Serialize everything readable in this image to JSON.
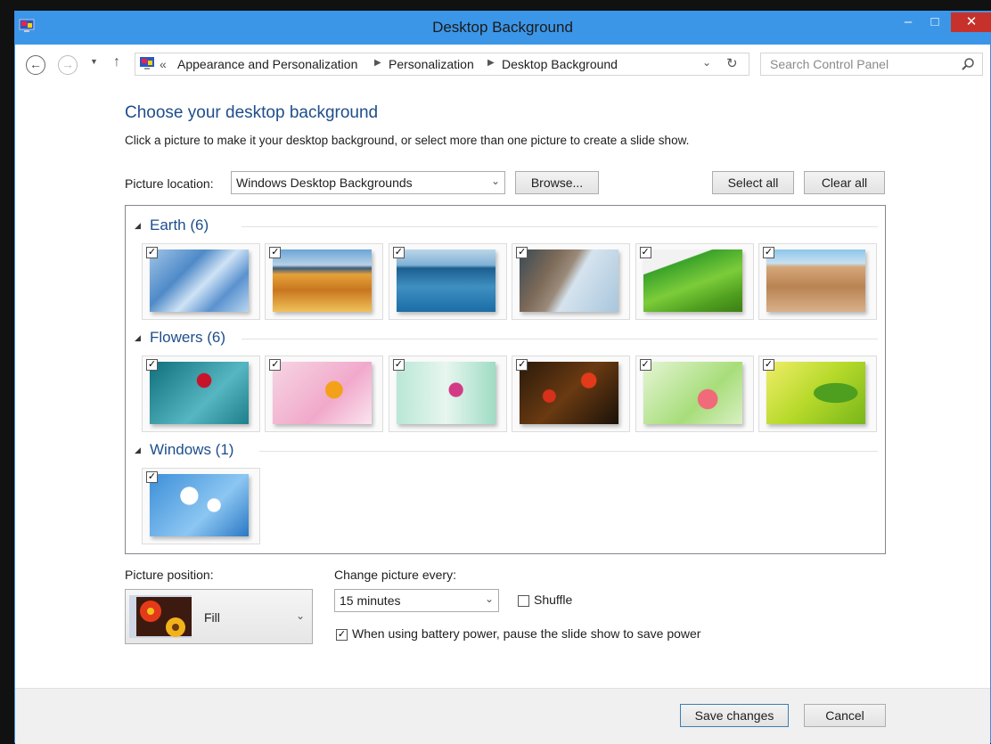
{
  "window": {
    "title": "Desktop Background",
    "min_glyph": "–",
    "max_glyph": "□",
    "close_glyph": "✕"
  },
  "nav": {
    "back_glyph": "←",
    "forward_glyph": "→",
    "up_glyph": "↑",
    "overflow": "«",
    "breadcrumbs": [
      "Appearance and Personalization",
      "Personalization",
      "Desktop Background"
    ],
    "search_placeholder": "Search Control Panel"
  },
  "main": {
    "heading": "Choose your desktop background",
    "description": "Click a picture to make it your desktop background, or select more than one picture to create a slide show.",
    "picture_location_label": "Picture location:",
    "picture_location_value": "Windows Desktop Backgrounds",
    "browse_label": "Browse...",
    "select_all_label": "Select all",
    "clear_all_label": "Clear all"
  },
  "groups": [
    {
      "title": "Earth (6)",
      "thumbs": [
        {
          "name": "ice",
          "checked": true
        },
        {
          "name": "canyon",
          "checked": true
        },
        {
          "name": "lake",
          "checked": true
        },
        {
          "name": "rock-shore",
          "checked": true
        },
        {
          "name": "green-field",
          "checked": true
        },
        {
          "name": "desert",
          "checked": true
        }
      ]
    },
    {
      "title": "Flowers (6)",
      "thumbs": [
        {
          "name": "red-flower-teal",
          "checked": true
        },
        {
          "name": "orange-flower-pink",
          "checked": true
        },
        {
          "name": "pink-flower-mint",
          "checked": true
        },
        {
          "name": "red-tulips-dark",
          "checked": true
        },
        {
          "name": "pink-flower-green",
          "checked": true
        },
        {
          "name": "green-leaves",
          "checked": true
        }
      ]
    },
    {
      "title": "Windows (1)",
      "thumbs": [
        {
          "name": "daisies-blue",
          "checked": true
        }
      ]
    }
  ],
  "options": {
    "picture_position_label": "Picture position:",
    "picture_position_value": "Fill",
    "change_every_label": "Change picture every:",
    "change_every_value": "15 minutes",
    "shuffle_label": "Shuffle",
    "shuffle_checked": false,
    "battery_label": "When using battery power, pause the slide show to save power",
    "battery_checked": true
  },
  "footer": {
    "save_label": "Save changes",
    "cancel_label": "Cancel"
  },
  "check_glyph": "✓",
  "colors": {
    "titlebar": "#3c96e8",
    "close": "#c7312b",
    "heading": "#1e4e8c"
  }
}
